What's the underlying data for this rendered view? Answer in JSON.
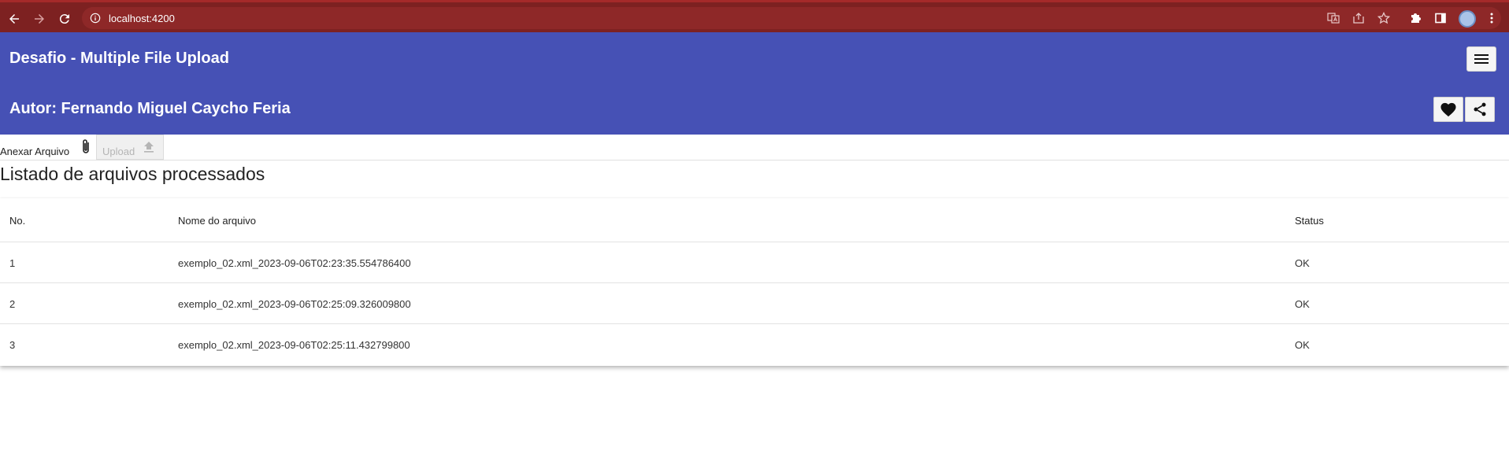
{
  "browser": {
    "url": "localhost:4200"
  },
  "header": {
    "title": "Desafio - Multiple File Upload",
    "author": "Autor: Fernando Miguel Caycho Feria",
    "background_color": "#4651b5"
  },
  "toolbar": {
    "attach_label": "Anexar Arquivo",
    "upload_label": "Upload"
  },
  "section": {
    "title": "Listado de arquivos processados"
  },
  "table": {
    "columns": [
      "No.",
      "Nome do arquivo",
      "Status"
    ],
    "rows": [
      {
        "no": "1",
        "name": "exemplo_02.xml_2023-09-06T02:23:35.554786400",
        "status": "OK"
      },
      {
        "no": "2",
        "name": "exemplo_02.xml_2023-09-06T02:25:09.326009800",
        "status": "OK"
      },
      {
        "no": "3",
        "name": "exemplo_02.xml_2023-09-06T02:25:11.432799800",
        "status": "OK"
      }
    ]
  },
  "icons": {
    "back": "arrow-left-icon",
    "forward": "arrow-right-icon",
    "reload": "reload-icon",
    "info": "info-icon",
    "translate": "translate-icon",
    "share_page": "share-page-icon",
    "bookmark": "star-icon",
    "extensions": "puzzle-icon",
    "side_panel": "side-panel-icon",
    "menu": "hamburger-menu-icon",
    "favorite": "heart-icon",
    "share": "share-icon",
    "attach": "paperclip-icon",
    "upload": "upload-icon"
  }
}
